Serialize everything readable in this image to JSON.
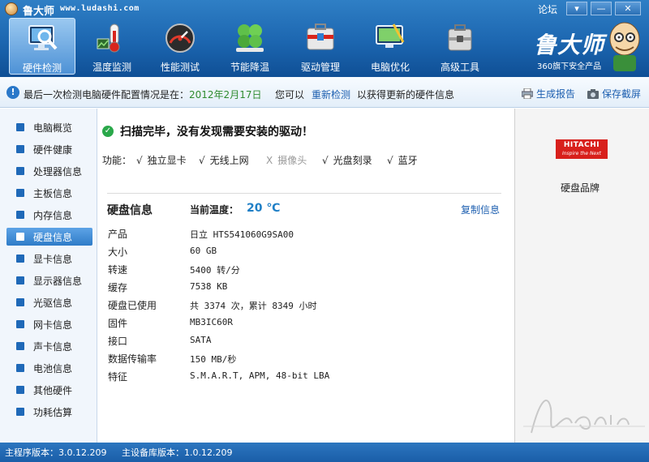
{
  "app": {
    "title": "鲁大师",
    "url": "www.ludashi.com",
    "forum": "论坛",
    "window_menu": "▾",
    "window_min": "—",
    "window_close": "✕"
  },
  "nav": {
    "tabs": [
      {
        "label": "硬件检测",
        "icon": "monitor-magnifier-icon",
        "active": true
      },
      {
        "label": "温度监测",
        "icon": "thermometer-icon",
        "active": false
      },
      {
        "label": "性能测试",
        "icon": "speedometer-icon",
        "active": false
      },
      {
        "label": "节能降温",
        "icon": "clover-icon",
        "active": false
      },
      {
        "label": "驱动管理",
        "icon": "toolbox-icon",
        "active": false
      },
      {
        "label": "电脑优化",
        "icon": "broom-monitor-icon",
        "active": false
      },
      {
        "label": "高级工具",
        "icon": "tool-case-icon",
        "active": false
      }
    ],
    "brand": "鲁大师",
    "brand_sub": "360旗下安全产品"
  },
  "infobar": {
    "text_prefix": "最后一次检测电脑硬件配置情况是在：",
    "date": "2012年2月17日",
    "may": "您可以",
    "recheck": "重新检测",
    "after": "以获得更新的硬件信息",
    "report": "生成报告",
    "save": "保存截屏"
  },
  "sidebar": {
    "items": [
      {
        "label": "电脑概览",
        "active": false
      },
      {
        "label": "硬件健康",
        "active": false
      },
      {
        "label": "处理器信息",
        "active": false
      },
      {
        "label": "主板信息",
        "active": false
      },
      {
        "label": "内存信息",
        "active": false
      },
      {
        "label": "硬盘信息",
        "active": true
      },
      {
        "label": "显卡信息",
        "active": false
      },
      {
        "label": "显示器信息",
        "active": false
      },
      {
        "label": "光驱信息",
        "active": false
      },
      {
        "label": "网卡信息",
        "active": false
      },
      {
        "label": "声卡信息",
        "active": false
      },
      {
        "label": "电池信息",
        "active": false
      },
      {
        "label": "其他硬件",
        "active": false
      },
      {
        "label": "功耗估算",
        "active": false
      }
    ]
  },
  "scan": {
    "message": "扫描完毕，没有发现需要安装的驱动！",
    "features_label": "功能：",
    "features": [
      {
        "mark": "√",
        "label": "独立显卡"
      },
      {
        "mark": "√",
        "label": "无线上网"
      },
      {
        "mark": "X",
        "label": "摄像头"
      },
      {
        "mark": "√",
        "label": "光盘刻录"
      },
      {
        "mark": "√",
        "label": "蓝牙"
      }
    ]
  },
  "disk": {
    "title": "硬盘信息",
    "temp_label": "当前温度：",
    "temp_value": "20 ℃",
    "copy": "复制信息",
    "rows": [
      {
        "label": "产品",
        "value": "日立 HTS541060G9SA00"
      },
      {
        "label": "大小",
        "value": "60 GB"
      },
      {
        "label": "转速",
        "value": "5400 转/分"
      },
      {
        "label": "缓存",
        "value": "7538 KB"
      },
      {
        "label": "硬盘已使用",
        "value": "共 3374 次，累计 8349 小时"
      },
      {
        "label": "固件",
        "value": "MB3IC60R"
      },
      {
        "label": "接口",
        "value": "SATA"
      },
      {
        "label": "数据传输率",
        "value": "150 MB/秒"
      },
      {
        "label": "特征",
        "value": "S.M.A.R.T,  APM,  48-bit LBA"
      }
    ]
  },
  "brand_panel": {
    "logo_line1": "HITACHI",
    "logo_line2": "Inspire the Next",
    "caption": "硬盘品牌"
  },
  "status": {
    "main_version": "主程序版本：3.0.12.209",
    "device_version": "主设备库版本：1.0.12.209"
  }
}
